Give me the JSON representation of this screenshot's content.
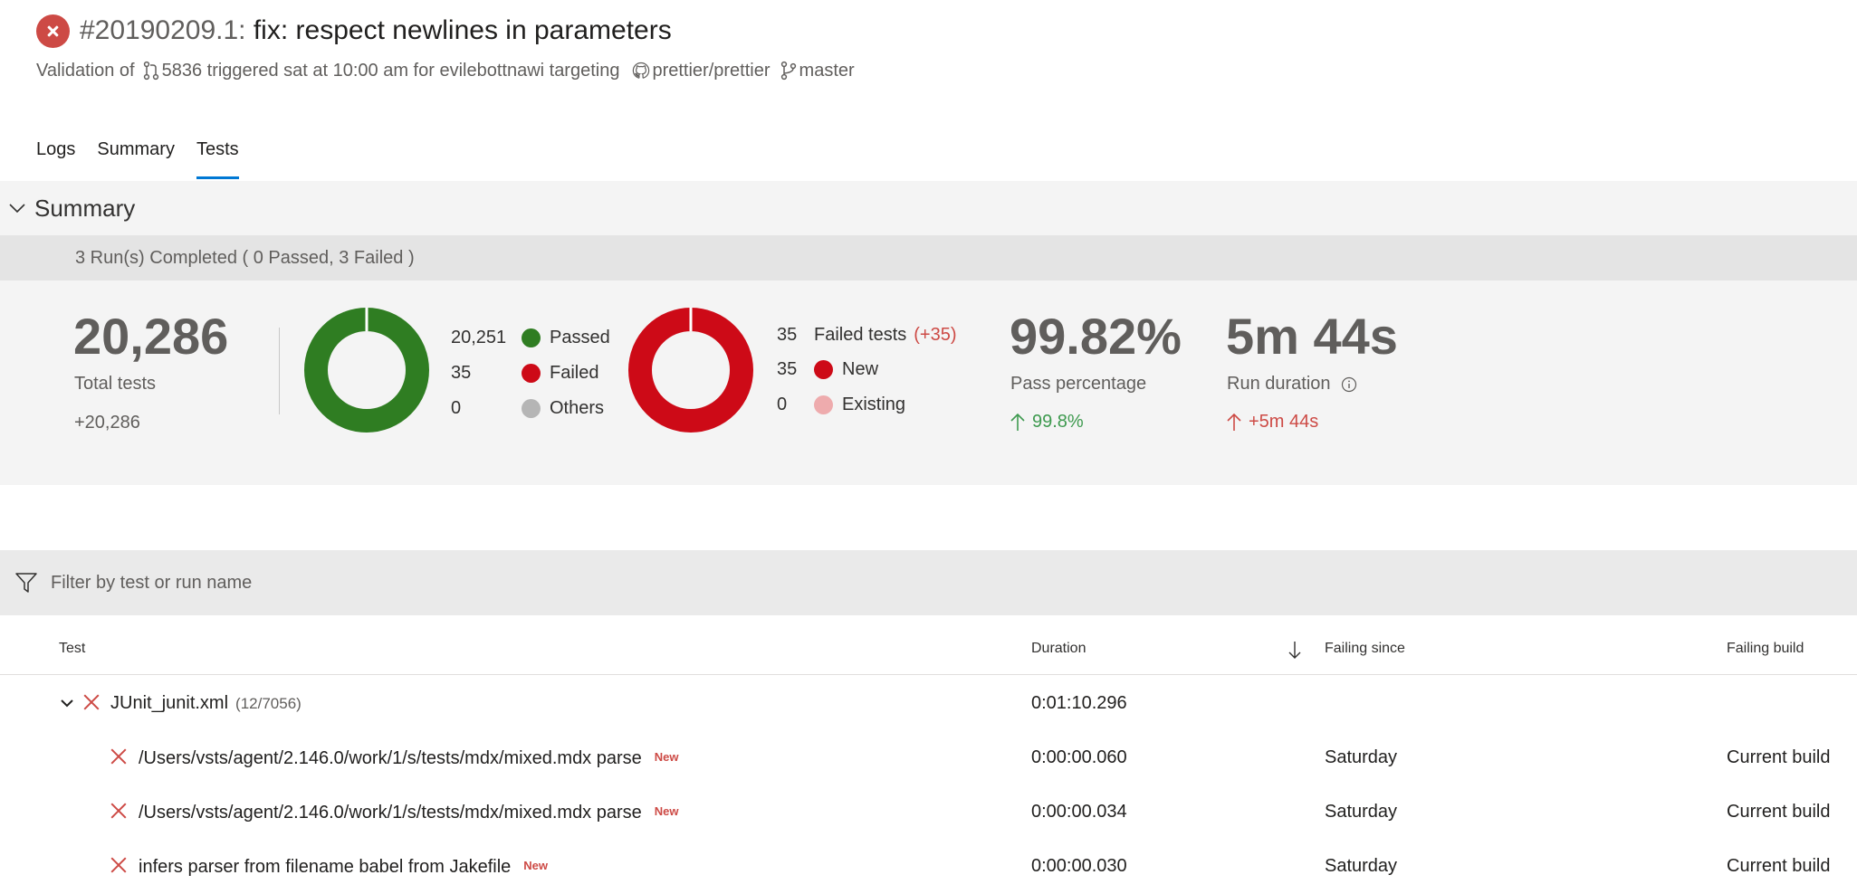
{
  "header": {
    "build_id": "#20190209.1:",
    "build_message": " fix: respect newlines in parameters",
    "sub_validation": "Validation of",
    "sub_pr": "5836 triggered sat at 10:00 am for evilebottnawi targeting",
    "sub_repo": "prettier/prettier",
    "sub_branch": "master"
  },
  "tabs": [
    {
      "label": "Logs"
    },
    {
      "label": "Summary"
    },
    {
      "label": "Tests"
    }
  ],
  "summary": {
    "title": "Summary",
    "runs_text": "3 Run(s) Completed ( 0 Passed, 3 Failed )",
    "total_tests": "20,286",
    "total_label": "Total tests",
    "total_delta": "+20,286",
    "outcome_legend": [
      {
        "count": "20,251",
        "label": "Passed",
        "color": "#2f7d22"
      },
      {
        "count": "35",
        "label": "Failed",
        "color": "#cd0a17"
      },
      {
        "count": "0",
        "label": "Others",
        "color": "#b5b5b5"
      }
    ],
    "outcome_values": {
      "passed": 20251,
      "failed": 35,
      "others": 0
    },
    "failed_legend": {
      "count": "35",
      "label": "Failed tests",
      "delta": "(+35)",
      "rows": [
        {
          "count": "35",
          "label": "New",
          "color": "#cd0a17"
        },
        {
          "count": "0",
          "label": "Existing",
          "color": "#eeabad"
        }
      ]
    },
    "failed_values": {
      "new": 35,
      "existing": 0
    },
    "pass_percentage": "99.82%",
    "pass_label": "Pass percentage",
    "pass_delta": "99.8%",
    "run_duration": "5m 44s",
    "run_label": "Run duration",
    "run_delta": "+5m 44s"
  },
  "filter": {
    "placeholder": "Filter by test or run name"
  },
  "table": {
    "headers": {
      "test": "Test",
      "duration": "Duration",
      "failing_since": "Failing since",
      "failing_build": "Failing build"
    },
    "group": {
      "name": "JUnit_junit.xml",
      "count": "(12/7056)",
      "duration": "0:01:10.296"
    },
    "rows": [
      {
        "name": "/Users/vsts/agent/2.146.0/work/1/s/tests/mdx/mixed.mdx parse",
        "badge": "New",
        "duration": "0:00:00.060",
        "since": "Saturday",
        "build": "Current build"
      },
      {
        "name": "/Users/vsts/agent/2.146.0/work/1/s/tests/mdx/mixed.mdx parse",
        "badge": "New",
        "duration": "0:00:00.034",
        "since": "Saturday",
        "build": "Current build"
      },
      {
        "name": "infers parser from filename babel from Jakefile",
        "badge": "New",
        "duration": "0:00:00.030",
        "since": "Saturday",
        "build": "Current build"
      }
    ]
  },
  "colors": {
    "accent": "#0078d4",
    "failed": "#cd0a17",
    "passed": "#2f7d22",
    "negative_delta": "#cd4a45",
    "positive_delta": "#3e9a4f"
  }
}
